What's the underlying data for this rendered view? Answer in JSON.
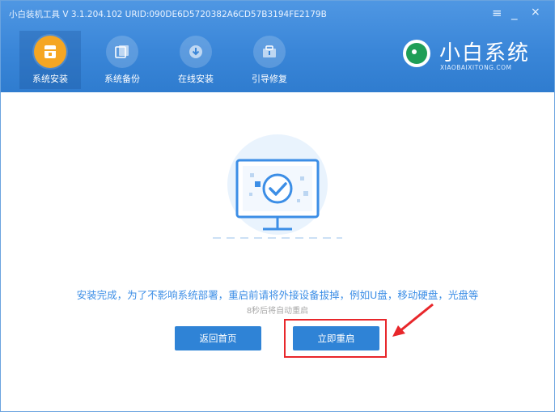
{
  "window": {
    "title": "小白装机工具 V 3.1.204.102 URID:090DE6D5720382A6CD57B3194FE2179B",
    "controls": {
      "menu": "≡",
      "minimize": "_",
      "close": "×"
    }
  },
  "nav": {
    "items": [
      {
        "label": "系统安装",
        "icon": "install-icon",
        "active": true
      },
      {
        "label": "系统备份",
        "icon": "backup-icon",
        "active": false
      },
      {
        "label": "在线安装",
        "icon": "download-icon",
        "active": false
      },
      {
        "label": "引导修复",
        "icon": "repair-icon",
        "active": false
      }
    ]
  },
  "brand": {
    "name": "小白系统",
    "url": "XIAOBAIXITONG.COM",
    "icon": "xiaobai-logo-icon"
  },
  "main": {
    "illustration": "monitor-check-icon",
    "message": "安装完成，为了不影响系统部署，重启前请将外接设备拔掉，例如U盘，移动硬盘，光盘等",
    "countdown": "8秒后将自动重启",
    "back_home_label": "返回首页",
    "restart_label": "立即重启"
  },
  "colors": {
    "header_blue": "#3a86d8",
    "accent_orange": "#f5a623",
    "button_blue": "#2f83d6",
    "message_blue": "#3c8ee6",
    "annotation_red": "#e8272b"
  }
}
